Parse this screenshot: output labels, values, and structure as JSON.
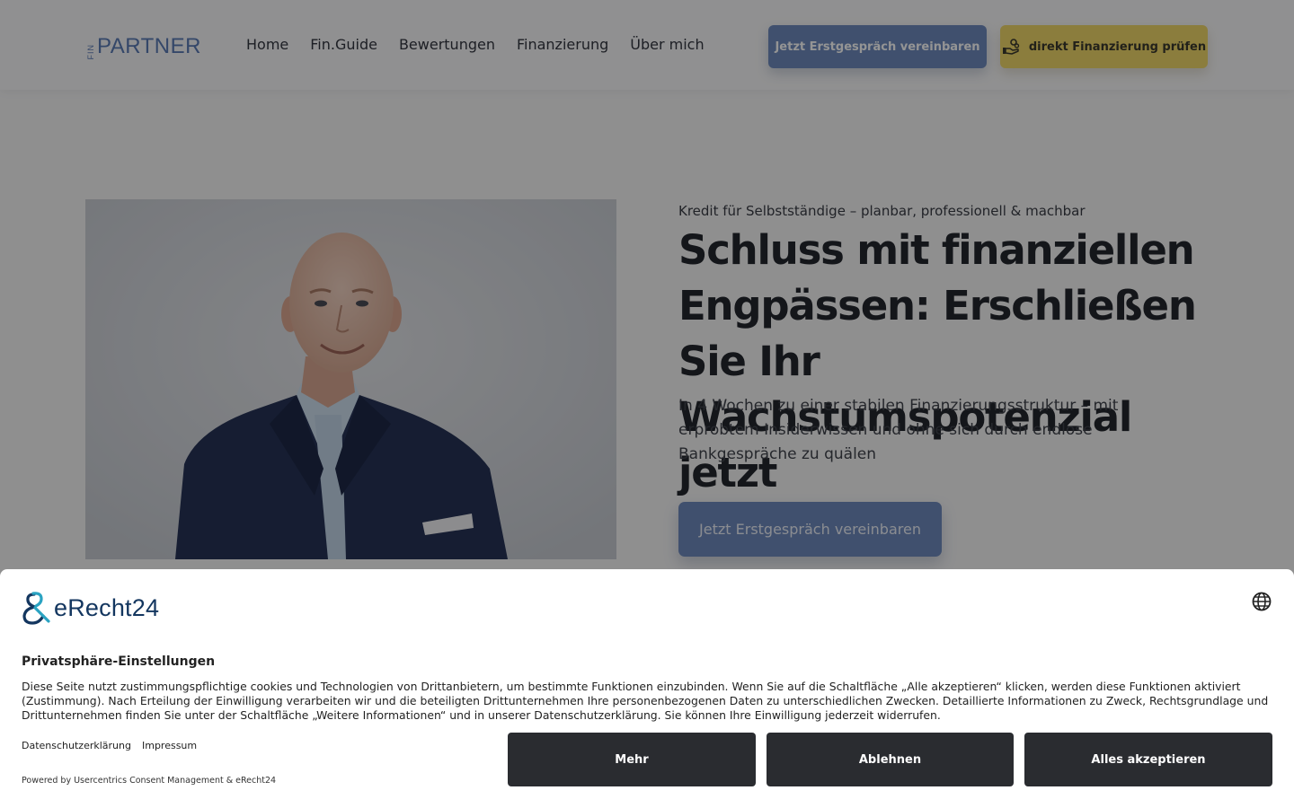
{
  "header": {
    "logo_fin": "FIN",
    "logo_partner": "PARTNER",
    "nav": [
      "Home",
      "Fin.Guide",
      "Bewertungen",
      "Finanzierung",
      "Über mich"
    ],
    "cta_primary": "Jetzt Erstgespräch vereinbaren",
    "cta_secondary": "direkt Finanzierung prüfen",
    "cta_secondary_icon": "hand-coins-icon"
  },
  "hero": {
    "eyebrow": "Kredit für Selbstständige – planbar, professionell & machbar",
    "headline": "Schluss mit finanziellen Engpässen: Erschließen Sie Ihr Wachstumspotenzial jetzt",
    "subtext": "In 4 Wochen zu einer stabilen Finanzierungsstruktur – mit erprobtem Insiderwissen und ohne sich durch endlose Bankgespräche zu quälen",
    "cta": "Jetzt Erstgespräch vereinbaren",
    "photo": "portrait-photo"
  },
  "consent": {
    "brand": "eRecht24",
    "title": "Privatsphäre-Einstellungen",
    "text": "Diese Seite nutzt zustimmungspflichtige cookies und Technologien von Drittanbietern, um bestimmte Funktionen einzubinden. Wenn Sie auf die Schaltfläche „Alle akzeptieren“ klicken, werden diese Funktionen aktiviert (Zustimmung). Nach Erteilung der Einwilligung verarbeiten wir und die beteiligten Drittunternehmen Ihre personenbezogenen Daten zu unterschiedlichen Zwecken. Detaillierte Informationen zu Zweck, Rechtsgrundlage und Drittunternehmen finden Sie unter der Schaltfläche „Weitere Informationen“ und in unserer Datenschutzerklärung. Sie können Ihre Einwilligung jederzeit widerrufen.",
    "link_privacy": "Datenschutzerklärung",
    "link_imprint": "Impressum",
    "powered": "Powered by Usercentrics Consent Management & eRecht24",
    "btn_more": "Mehr",
    "btn_decline": "Ablehnen",
    "btn_accept": "Alles akzeptieren"
  },
  "colors": {
    "accent_blue": "#6f8bbd",
    "accent_yellow": "#f0d76a",
    "consent_button": "#2a2c30",
    "brand_teal": "#1e7fa0"
  }
}
